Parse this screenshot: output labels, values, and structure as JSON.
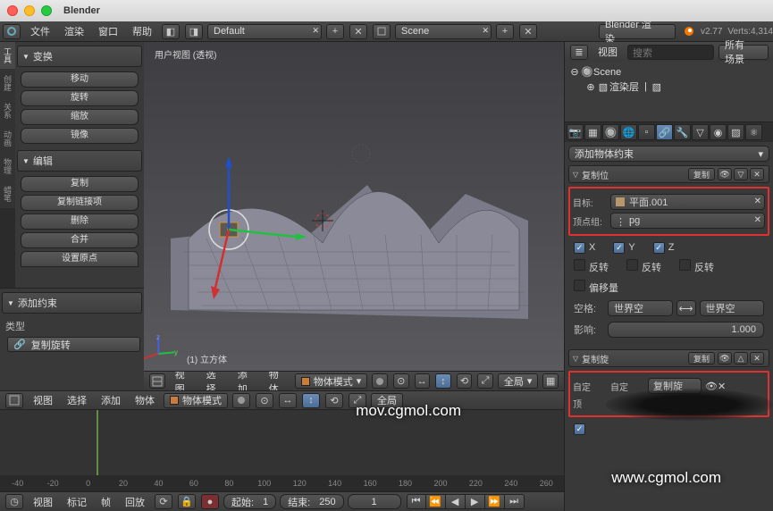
{
  "app": {
    "name": "Blender"
  },
  "topmenu": {
    "file": "文件",
    "render": "渲染",
    "window": "窗口",
    "help": "帮助",
    "layout": "Default",
    "scene": "Scene",
    "engine": "Blender 渲染",
    "version": "v2.77",
    "stats": "Verts:4,314"
  },
  "left": {
    "transform": "变换",
    "move": "移动",
    "rotate": "旋转",
    "scale": "缩放",
    "mirror": "镜像",
    "edit": "编辑",
    "dup": "复制",
    "duplink": "复制链接项",
    "del": "删除",
    "join": "合并",
    "setorigin": "设置原点",
    "addc": "添加约束",
    "type": "类型",
    "copyrot": "复制旋转"
  },
  "view": {
    "title": "用户视图 (透视)",
    "obj": "(1) 立方体"
  },
  "vpbar": {
    "view": "视图",
    "select": "选择",
    "add": "添加",
    "object": "物体",
    "mode": "物体模式",
    "global": "全局"
  },
  "tl": {
    "view": "视图",
    "marker": "标记",
    "frame": "帧",
    "playback": "回放",
    "start": "起始:",
    "start_v": "1",
    "end": "结束:",
    "end_v": "250",
    "cur": "1",
    "ticks": [
      "-40",
      "-20",
      "0",
      "20",
      "40",
      "60",
      "80",
      "100",
      "120",
      "140",
      "160",
      "180",
      "200",
      "220",
      "240",
      "260"
    ]
  },
  "out": {
    "view": "视图",
    "search": "搜索",
    "filter": "所有场景",
    "scene": "Scene",
    "renderlayer": "渲染层"
  },
  "prop": {
    "addcon": "添加物体约束",
    "c1": {
      "name": "复制位",
      "short": "复制"
    },
    "target": "目标:",
    "target_v": "平面.001",
    "vg": "顶点组:",
    "vg_v": "pg",
    "x": "X",
    "y": "Y",
    "z": "Z",
    "invert": "反转",
    "offset": "偏移量",
    "space": "空格:",
    "world": "世界空",
    "world2": "世界空",
    "influence": "影响:",
    "inf_v": "1.000",
    "c2": {
      "name": "复制旋",
      "short": "复制"
    },
    "c2_f1": "自定",
    "c2_f2": "自定",
    "c2_f3": "复制旋",
    "c2_vg": "顶"
  },
  "watermark": "www.cgmol.com",
  "watermark2": "mov.cgmol.com"
}
